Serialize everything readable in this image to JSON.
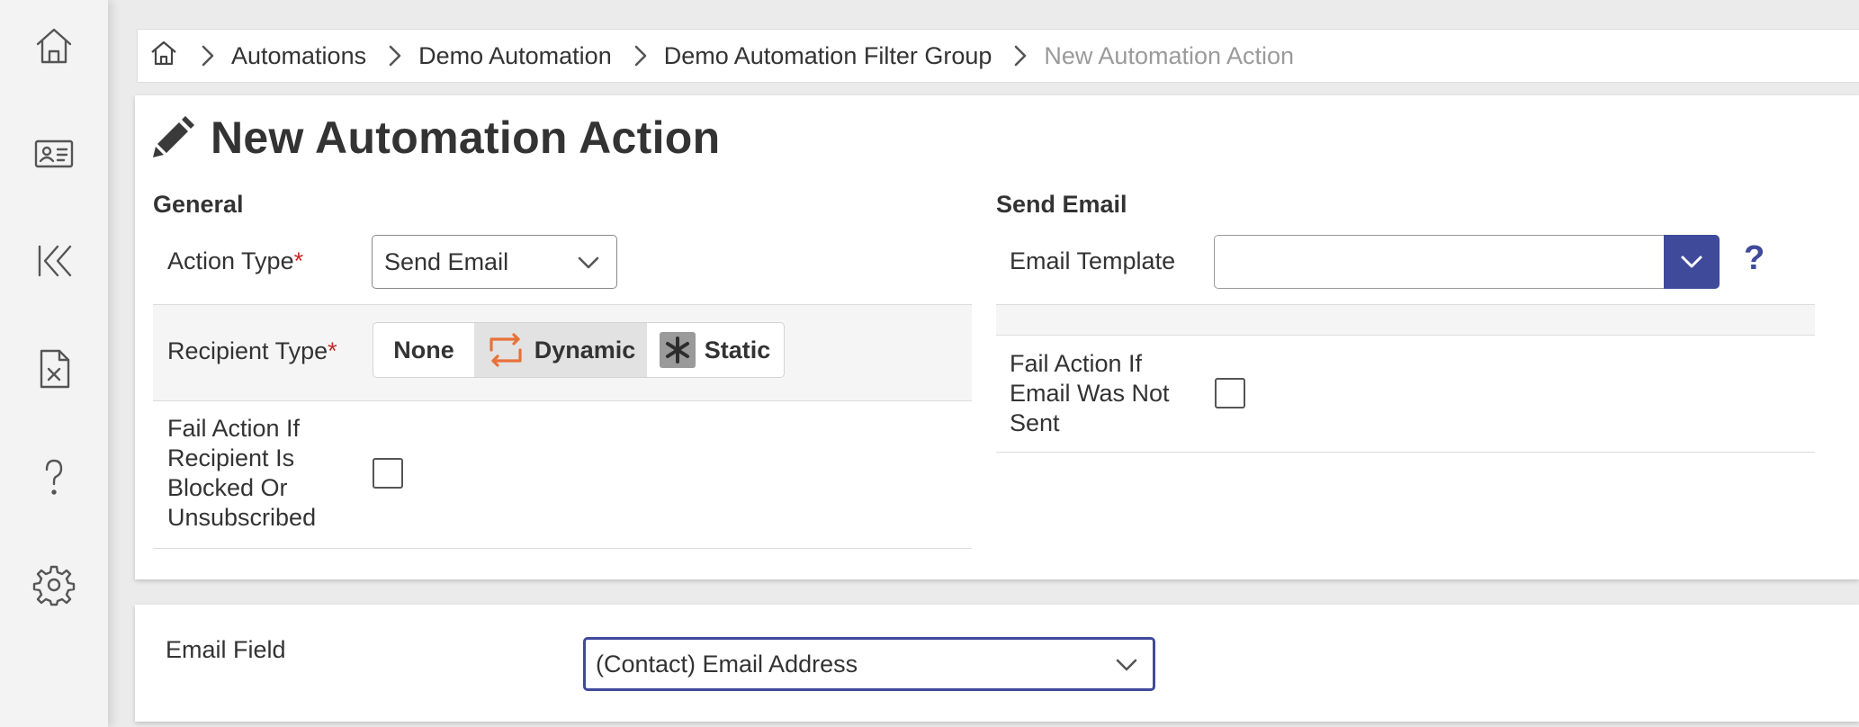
{
  "sidebar": {
    "items": [
      {
        "icon": "home-icon"
      },
      {
        "icon": "contact-card-icon"
      },
      {
        "icon": "rewind-icon"
      },
      {
        "icon": "excel-file-icon"
      },
      {
        "icon": "question-icon"
      },
      {
        "icon": "gear-icon"
      }
    ]
  },
  "breadcrumb": {
    "items": [
      "Automations",
      "Demo Automation",
      "Demo Automation Filter Group"
    ],
    "current": "New Automation Action"
  },
  "page": {
    "title": "New Automation Action"
  },
  "general": {
    "heading": "General",
    "action_type_label": "Action Type",
    "action_type_value": "Send Email",
    "recipient_type_label": "Recipient Type",
    "recipient_options": [
      "None",
      "Dynamic",
      "Static"
    ],
    "recipient_selected": "Dynamic",
    "fail_blocked_label_lines": [
      "Fail Action If",
      "Recipient Is",
      "Blocked Or",
      "Unsubscribed"
    ],
    "fail_blocked_checked": false,
    "required_marker": "*"
  },
  "send_email": {
    "heading": "Send Email",
    "template_label": "Email Template",
    "template_value": "",
    "help_label": "?",
    "fail_not_sent_label_lines": [
      "Fail Action If",
      "Email Was Not",
      "Sent"
    ],
    "fail_not_sent_checked": false
  },
  "email_field": {
    "label": "Email Field",
    "value": "(Contact) Email Address"
  },
  "colors": {
    "accent": "#3f4a9a",
    "required": "#c62828",
    "dynamic_icon": "#e8713a",
    "breadcrumb_current": "#9a9a9a"
  }
}
